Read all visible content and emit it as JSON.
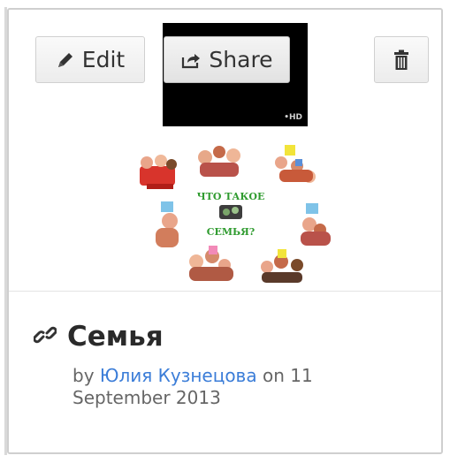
{
  "toolbar": {
    "edit_label": "Edit",
    "share_label": "Share"
  },
  "art": {
    "caption_line1": "ЧТО ТАКОЕ",
    "caption_line2": "СЕМЬЯ?"
  },
  "item": {
    "title": "Семья",
    "by_prefix": "by",
    "author": "Юлия Кузнецова",
    "date_prefix": "on",
    "date": "11 September 2013"
  },
  "colors": {
    "link": "#3b7dd8",
    "title": "#2a2a2a",
    "meta": "#666666",
    "caption": "#2f9b2f"
  },
  "icons": {
    "edit": "pencil-icon",
    "share": "share-icon",
    "delete": "trash-icon",
    "title": "link-icon"
  }
}
